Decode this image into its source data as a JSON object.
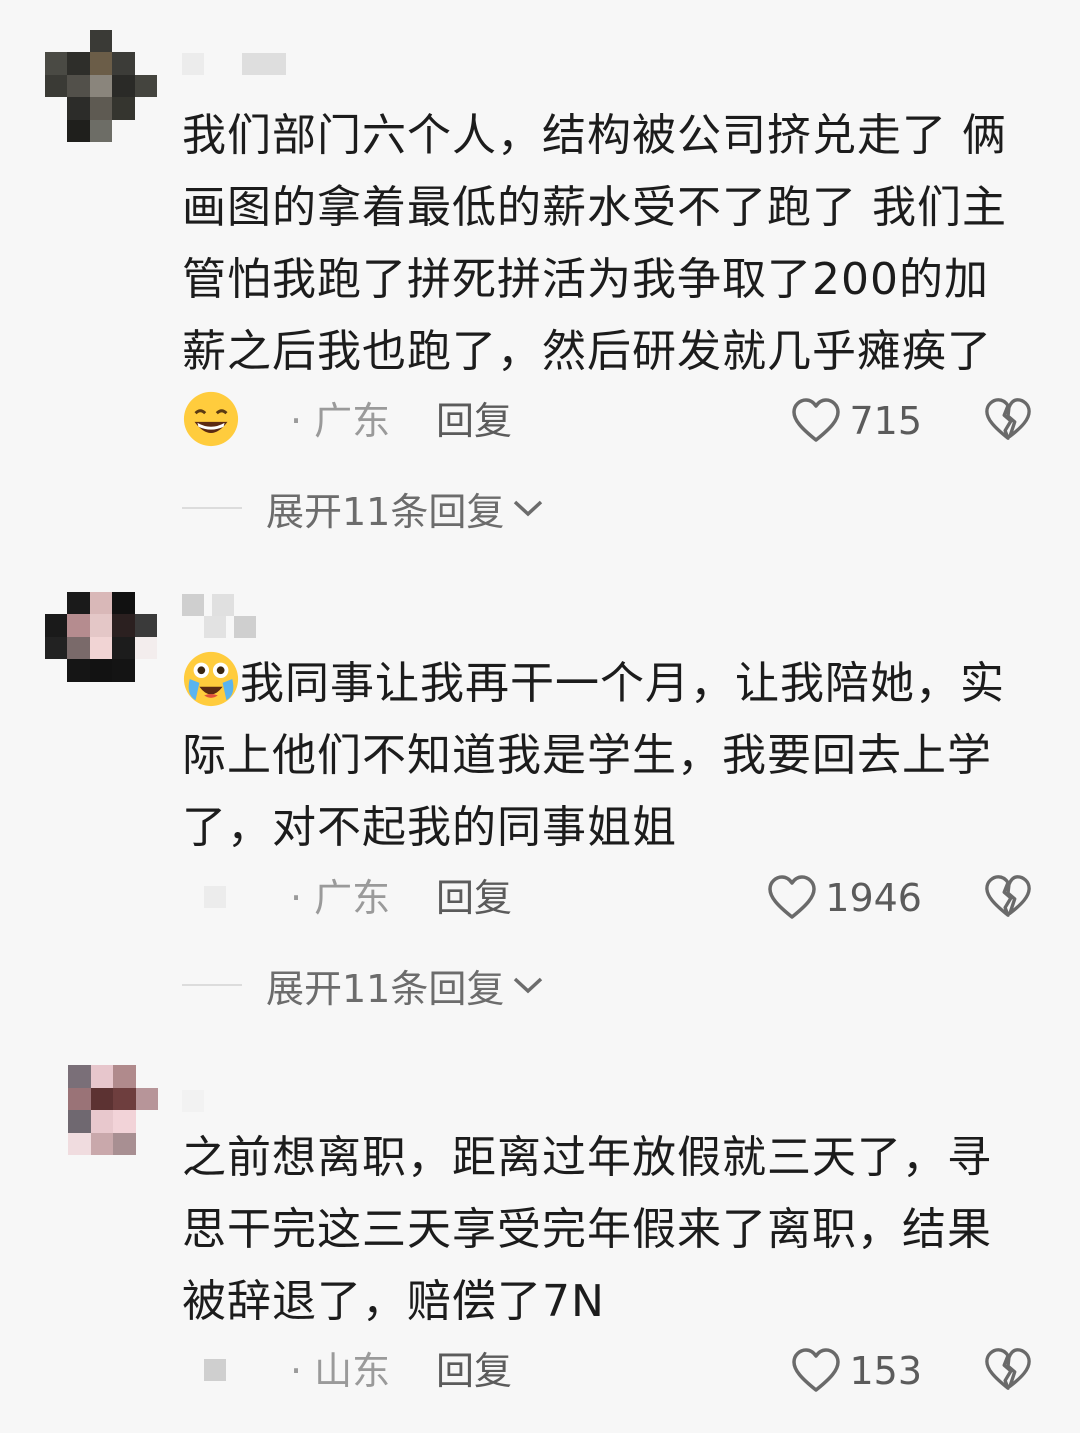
{
  "comments": [
    {
      "text": "我们部门六个人，结构被公司挤兑走了 俩画图的拿着最低的薪水受不了跑了 我们主管怕我跑了拼死拼活为我争取了200的加薪之后我也跑了，然后研发就几乎瘫痪了",
      "emoji": "grinning-sweat-emoji",
      "location": "· 广东",
      "reply_label": "回复",
      "likes": "715",
      "expand_label": "展开11条回复"
    },
    {
      "text": "我同事让我再干一个月，让我陪她，实际上他们不知道我是学生，我要回去上学了，对不起我的同事姐姐",
      "emoji": "crying-emoji",
      "location": "· 广东",
      "reply_label": "回复",
      "likes": "1946",
      "expand_label": "展开11条回复"
    },
    {
      "text": "之前想离职，距离过年放假就三天了，寻思干完这三天享受完年假来了离职，结果被辞退了，赔偿了7N",
      "location": "· 山东",
      "reply_label": "回复",
      "likes": "153"
    }
  ],
  "colors": {
    "background": "#f7f7f7",
    "text": "#1c1c1c",
    "secondary_text": "#9a9a9a",
    "icon": "#6a6a6a"
  }
}
